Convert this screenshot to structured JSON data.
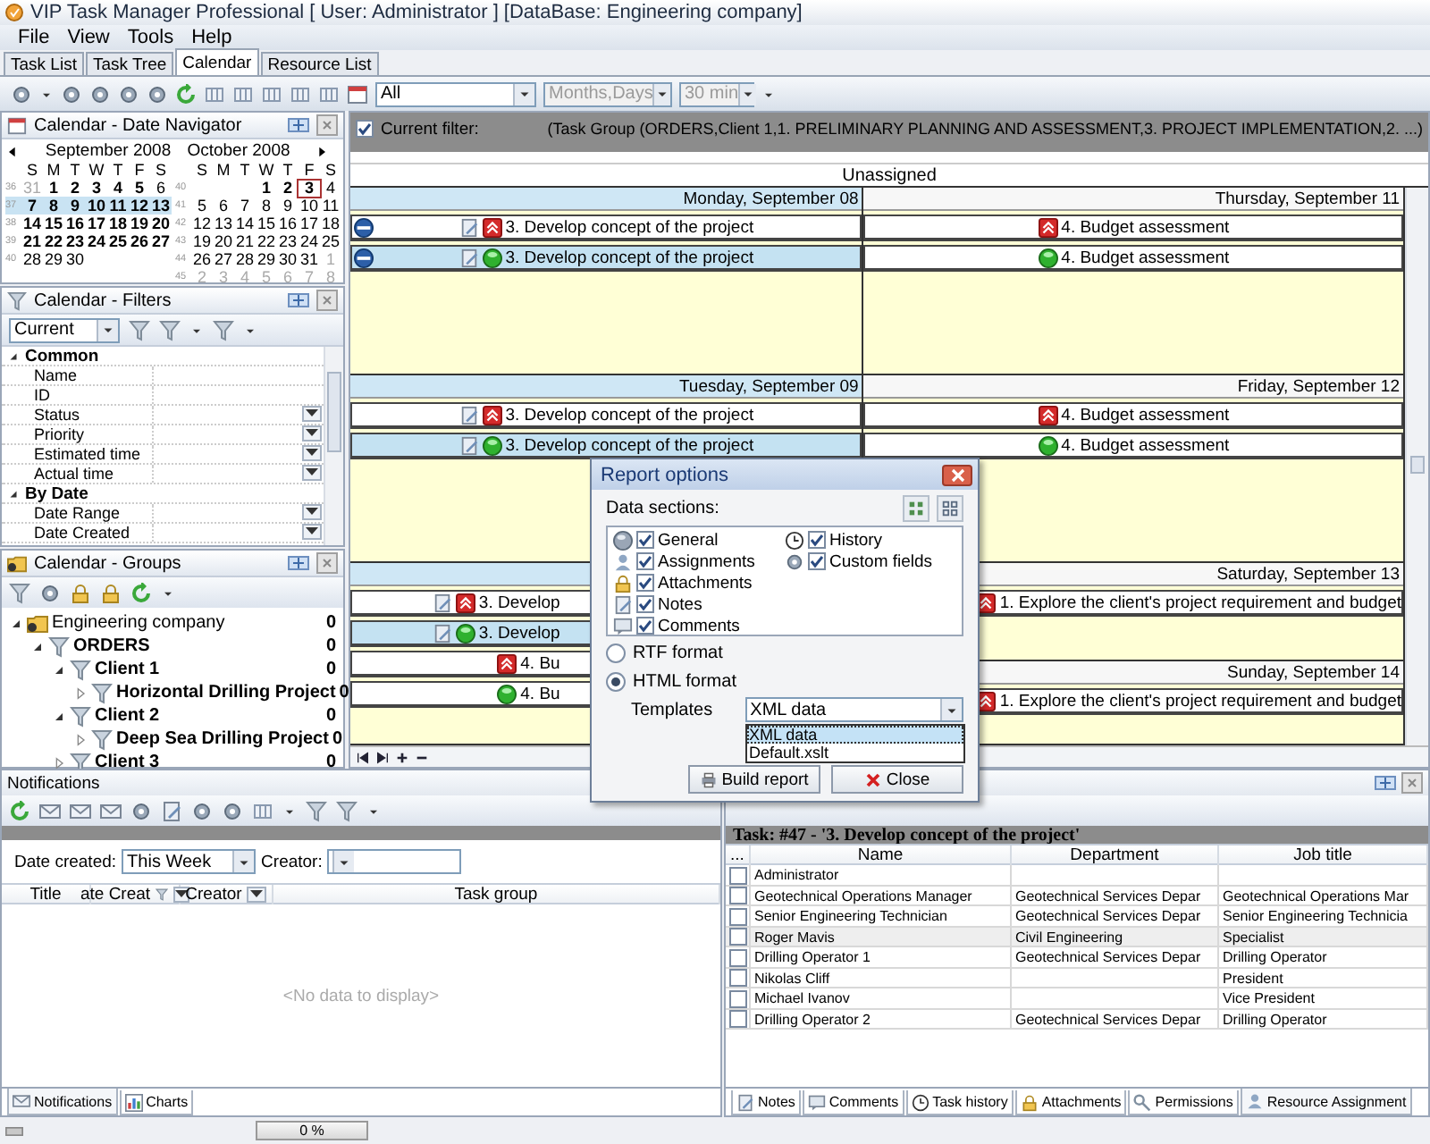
{
  "window": {
    "title": "VIP Task Manager Professional [ User: Administrator ] [DataBase: Engineering company]"
  },
  "menu": [
    "File",
    "View",
    "Tools",
    "Help"
  ],
  "tabs": [
    {
      "label": "Task List",
      "selected": false
    },
    {
      "label": "Task Tree",
      "selected": false
    },
    {
      "label": "Calendar",
      "selected": true
    },
    {
      "label": "Resource List",
      "selected": false
    }
  ],
  "toolbar": {
    "combos": [
      {
        "value": "All",
        "disabled": false
      },
      {
        "value": "Months,Days",
        "disabled": true
      },
      {
        "value": "30 min",
        "disabled": true
      }
    ]
  },
  "date_navigator": {
    "title": "Calendar - Date Navigator",
    "months": [
      {
        "name": "September 2008",
        "weekdays": [
          "S",
          "M",
          "T",
          "W",
          "T",
          "F",
          "S"
        ],
        "weeks": [
          {
            "number": "36",
            "selected": false,
            "days": [
              {
                "d": "31",
                "kind": "other"
              },
              {
                "d": "1",
                "kind": "bold"
              },
              {
                "d": "2",
                "kind": "bold"
              },
              {
                "d": "3",
                "kind": "bold"
              },
              {
                "d": "4",
                "kind": "bold"
              },
              {
                "d": "5",
                "kind": "bold"
              },
              {
                "d": "6",
                "kind": "plain"
              }
            ]
          },
          {
            "number": "37",
            "selected": true,
            "days": [
              {
                "d": "7",
                "kind": "bold"
              },
              {
                "d": "8",
                "kind": "bold"
              },
              {
                "d": "9",
                "kind": "bold"
              },
              {
                "d": "10",
                "kind": "bold"
              },
              {
                "d": "11",
                "kind": "bold"
              },
              {
                "d": "12",
                "kind": "bold"
              },
              {
                "d": "13",
                "kind": "bold"
              }
            ]
          },
          {
            "number": "38",
            "selected": false,
            "days": [
              {
                "d": "14",
                "kind": "bold"
              },
              {
                "d": "15",
                "kind": "bold"
              },
              {
                "d": "16",
                "kind": "bold"
              },
              {
                "d": "17",
                "kind": "bold"
              },
              {
                "d": "18",
                "kind": "bold"
              },
              {
                "d": "19",
                "kind": "bold"
              },
              {
                "d": "20",
                "kind": "bold"
              }
            ]
          },
          {
            "number": "39",
            "selected": false,
            "days": [
              {
                "d": "21",
                "kind": "bold"
              },
              {
                "d": "22",
                "kind": "bold"
              },
              {
                "d": "23",
                "kind": "bold"
              },
              {
                "d": "24",
                "kind": "bold"
              },
              {
                "d": "25",
                "kind": "bold"
              },
              {
                "d": "26",
                "kind": "bold"
              },
              {
                "d": "27",
                "kind": "bold"
              }
            ]
          },
          {
            "number": "40",
            "selected": false,
            "days": [
              {
                "d": "28",
                "kind": "plain"
              },
              {
                "d": "29",
                "kind": "plain"
              },
              {
                "d": "30",
                "kind": "plain"
              }
            ]
          }
        ]
      },
      {
        "name": "October 2008",
        "weekdays": [
          "S",
          "M",
          "T",
          "W",
          "T",
          "F",
          "S"
        ],
        "weeks": [
          {
            "number": "40",
            "selected": false,
            "days": [
              {
                "kind": "blank"
              },
              {
                "kind": "blank"
              },
              {
                "kind": "blank"
              },
              {
                "d": "1",
                "kind": "bold"
              },
              {
                "d": "2",
                "kind": "bold"
              },
              {
                "d": "3",
                "kind": "today"
              },
              {
                "d": "4",
                "kind": "plain"
              }
            ]
          },
          {
            "number": "41",
            "selected": false,
            "days": [
              {
                "d": "5",
                "kind": "plain"
              },
              {
                "d": "6",
                "kind": "plain"
              },
              {
                "d": "7",
                "kind": "plain"
              },
              {
                "d": "8",
                "kind": "plain"
              },
              {
                "d": "9",
                "kind": "plain"
              },
              {
                "d": "10",
                "kind": "plain"
              },
              {
                "d": "11",
                "kind": "plain"
              }
            ]
          },
          {
            "number": "42",
            "selected": false,
            "days": [
              {
                "d": "12",
                "kind": "plain"
              },
              {
                "d": "13",
                "kind": "plain"
              },
              {
                "d": "14",
                "kind": "plain"
              },
              {
                "d": "15",
                "kind": "plain"
              },
              {
                "d": "16",
                "kind": "plain"
              },
              {
                "d": "17",
                "kind": "plain"
              },
              {
                "d": "18",
                "kind": "plain"
              }
            ]
          },
          {
            "number": "43",
            "selected": false,
            "days": [
              {
                "d": "19",
                "kind": "plain"
              },
              {
                "d": "20",
                "kind": "plain"
              },
              {
                "d": "21",
                "kind": "plain"
              },
              {
                "d": "22",
                "kind": "plain"
              },
              {
                "d": "23",
                "kind": "plain"
              },
              {
                "d": "24",
                "kind": "plain"
              },
              {
                "d": "25",
                "kind": "plain"
              }
            ]
          },
          {
            "number": "44",
            "selected": false,
            "days": [
              {
                "d": "26",
                "kind": "plain"
              },
              {
                "d": "27",
                "kind": "plain"
              },
              {
                "d": "28",
                "kind": "plain"
              },
              {
                "d": "29",
                "kind": "plain"
              },
              {
                "d": "30",
                "kind": "plain"
              },
              {
                "d": "31",
                "kind": "plain"
              },
              {
                "d": "1",
                "kind": "other"
              }
            ]
          },
          {
            "number": "45",
            "selected": false,
            "days": [
              {
                "d": "2",
                "kind": "other"
              },
              {
                "d": "3",
                "kind": "other"
              },
              {
                "d": "4",
                "kind": "other"
              },
              {
                "d": "5",
                "kind": "other"
              },
              {
                "d": "6",
                "kind": "other"
              },
              {
                "d": "7",
                "kind": "other"
              },
              {
                "d": "8",
                "kind": "other"
              }
            ]
          }
        ]
      }
    ]
  },
  "filters": {
    "title": "Calendar - Filters",
    "preset": "Current",
    "groups": [
      {
        "label": "Common",
        "expanded": true,
        "children": [
          {
            "label": "Name",
            "dropdown": false
          },
          {
            "label": "ID",
            "dropdown": false
          },
          {
            "label": "Status",
            "dropdown": true
          },
          {
            "label": "Priority",
            "dropdown": true
          },
          {
            "label": "Estimated time",
            "dropdown": true
          },
          {
            "label": "Actual time",
            "dropdown": true
          }
        ]
      },
      {
        "label": "By Date",
        "expanded": true,
        "children": [
          {
            "label": "Date Range",
            "dropdown": true
          },
          {
            "label": "Date Created",
            "dropdown": true
          }
        ]
      }
    ]
  },
  "groups": {
    "title": "Calendar - Groups",
    "tree": [
      {
        "label": "Engineering company",
        "count": "0",
        "kind": "company",
        "expanded": true,
        "children": [
          {
            "label": "ORDERS",
            "count": "0",
            "kind": "group",
            "expanded": true,
            "children": [
              {
                "label": "Client 1",
                "count": "0",
                "kind": "group",
                "expanded": true,
                "children": [
                  {
                    "label": "Horizontal Drilling Project",
                    "count": "0",
                    "kind": "group",
                    "expanded": false
                  }
                ]
              },
              {
                "label": "Client 2",
                "count": "0",
                "kind": "group",
                "expanded": true,
                "children": [
                  {
                    "label": "Deep Sea Drilling Project",
                    "count": "0",
                    "kind": "group",
                    "expanded": false
                  }
                ]
              },
              {
                "label": "Client 3",
                "count": "0",
                "kind": "group",
                "expanded": false
              }
            ]
          }
        ]
      }
    ]
  },
  "calendar": {
    "filter": {
      "checked": true,
      "label": "Current filter:",
      "text": "(Task Group  (ORDERS,Client 1,1. PRELIMINARY PLANNING AND ASSESSMENT,3. PROJECT IMPLEMENTATION,2. ...)"
    },
    "resource": "Unassigned",
    "columns": [
      [
        {
          "date": "Monday, September 08",
          "highlighted": true,
          "items": [
            {
              "text": "3. Develop concept of the project",
              "completed": false,
              "note": true,
              "recurring": true,
              "selected": false
            },
            {
              "text": "3. Develop concept of the project",
              "completed": true,
              "note": true,
              "recurring": true,
              "selected": true
            }
          ]
        },
        {
          "date": "Tuesday, September 09",
          "highlighted": true,
          "items": [
            {
              "text": "3. Develop concept of the project",
              "completed": false,
              "note": true,
              "recurring": false,
              "selected": false
            },
            {
              "text": "3. Develop concept of the project",
              "completed": true,
              "note": true,
              "recurring": false,
              "selected": true
            }
          ]
        },
        {
          "highlighted": true,
          "items": [
            {
              "text": "3. Develop",
              "completed": false,
              "note": true,
              "recurring": false,
              "selected": false
            },
            {
              "text": "3. Develop",
              "completed": true,
              "note": true,
              "recurring": false,
              "selected": true
            },
            {
              "text": "4. Bu",
              "completed": false,
              "note": false,
              "recurring": false,
              "selected": false
            },
            {
              "text": "4. Bu",
              "completed": true,
              "note": false,
              "recurring": false,
              "selected": false
            }
          ]
        }
      ],
      [
        {
          "date": "Thursday, September 11",
          "highlighted": false,
          "items": [
            {
              "text": "4. Budget assessment",
              "completed": false,
              "note": false,
              "recurring": false,
              "selected": false
            },
            {
              "text": "4. Budget assessment",
              "completed": true,
              "note": false,
              "recurring": false,
              "selected": false
            }
          ]
        },
        {
          "date": "Friday, September 12",
          "highlighted": false,
          "items": [
            {
              "text": "4. Budget assessment",
              "completed": false,
              "note": false,
              "recurring": false,
              "selected": false
            },
            {
              "text": "4. Budget assessment",
              "completed": true,
              "note": false,
              "recurring": false,
              "selected": false
            }
          ]
        },
        {
          "date": "Saturday, September 13",
          "highlighted": false,
          "items": [
            {
              "text": "1. Explore the client's project requirement and budget",
              "completed": false,
              "note": false,
              "recurring": false,
              "selected": false
            }
          ]
        },
        {
          "date": "Sunday, September 14",
          "highlighted": false,
          "items": [
            {
              "text": "1. Explore the client's project requirement and budget",
              "completed": false,
              "note": false,
              "recurring": false,
              "selected": false
            }
          ]
        }
      ]
    ]
  },
  "report_dialog": {
    "title": "Report options",
    "sections_label": "Data sections:",
    "sections": [
      {
        "label": "General",
        "checked": true
      },
      {
        "label": "Assignments",
        "checked": true
      },
      {
        "label": "Attachments",
        "checked": true
      },
      {
        "label": "Notes",
        "checked": true
      },
      {
        "label": "Comments",
        "checked": true
      },
      {
        "label": "History",
        "checked": true
      },
      {
        "label": "Custom fields",
        "checked": true
      }
    ],
    "formats": [
      {
        "label": "RTF format",
        "selected": false
      },
      {
        "label": "HTML format",
        "selected": true
      }
    ],
    "templates_label": "Templates",
    "template": "XML data",
    "template_options": [
      {
        "label": "XML data",
        "selected": true
      },
      {
        "label": "Default.xslt",
        "selected": false
      }
    ],
    "buttons": [
      "Build report",
      "Close"
    ]
  },
  "notifications": {
    "title": "Notifications",
    "date_label": "Date created:",
    "date_value": "This Week",
    "creator_label": "Creator:",
    "columns": [
      "Title",
      "ate Creat",
      "Creator",
      "Task group"
    ],
    "empty": "<No data to display>",
    "tabs": [
      {
        "label": "Notifications",
        "selected": true
      },
      {
        "label": "Charts",
        "selected": false
      }
    ]
  },
  "resources": {
    "task": "Task: #47 -  '3. Develop concept of the project'",
    "columns": [
      "...",
      "Name",
      "Department",
      "Job title"
    ],
    "rows": [
      {
        "checked": false,
        "selected": false,
        "name": "Administrator"
      },
      {
        "checked": false,
        "selected": false,
        "name": "Geotechnical Operations Manager",
        "department": "Geotechnical Services Depar",
        "job": "Geotechnical Operations Mar"
      },
      {
        "checked": false,
        "selected": false,
        "name": "Senior Engineering Technician",
        "department": "Geotechnical Services Depar",
        "job": "Senior Engineering Technicia"
      },
      {
        "checked": false,
        "selected": true,
        "name": "Roger Mavis",
        "department": "Civil Engineering",
        "job": "Specialist"
      },
      {
        "checked": false,
        "selected": false,
        "name": "Drilling Operator 1",
        "department": "Geotechnical Services Depar",
        "job": "Drilling Operator"
      },
      {
        "checked": false,
        "selected": false,
        "name": "Nikolas Cliff",
        "job": "President"
      },
      {
        "checked": false,
        "selected": false,
        "name": "Michael Ivanov",
        "job": "Vice President"
      },
      {
        "checked": false,
        "selected": false,
        "name": "Drilling Operator 2",
        "department": "Geotechnical Services Depar",
        "job": "Drilling Operator"
      }
    ],
    "tabs": [
      {
        "label": "Notes",
        "selected": false
      },
      {
        "label": "Comments",
        "selected": false
      },
      {
        "label": "Task history",
        "selected": false
      },
      {
        "label": "Attachments",
        "selected": false
      },
      {
        "label": "Permissions",
        "selected": false
      },
      {
        "label": "Resource Assignment",
        "selected": true
      }
    ]
  },
  "status_bar": {
    "progress": {
      "level": 0,
      "text": "0 %"
    }
  }
}
